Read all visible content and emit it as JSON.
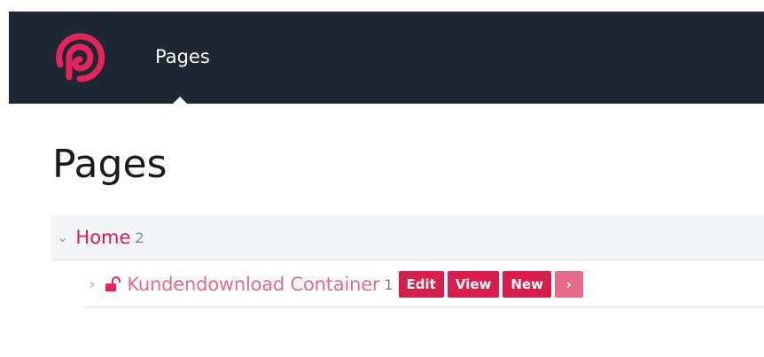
{
  "header": {
    "nav_item": "Pages",
    "logo_icon": "pimcore-logo-icon",
    "background_color": "#1f2733",
    "accent_color": "#d61f4d"
  },
  "main": {
    "title": "Pages",
    "tree": {
      "root": {
        "label": "Home",
        "count": "2",
        "expand_icon": "chevron-down-icon"
      },
      "child": {
        "label": "Kundendownload Container",
        "count": "1",
        "expand_icon": "chevron-right-icon",
        "lock_icon": "unlock-icon",
        "buttons": {
          "edit": "Edit",
          "view": "View",
          "new": "New",
          "more": "›"
        }
      }
    }
  }
}
